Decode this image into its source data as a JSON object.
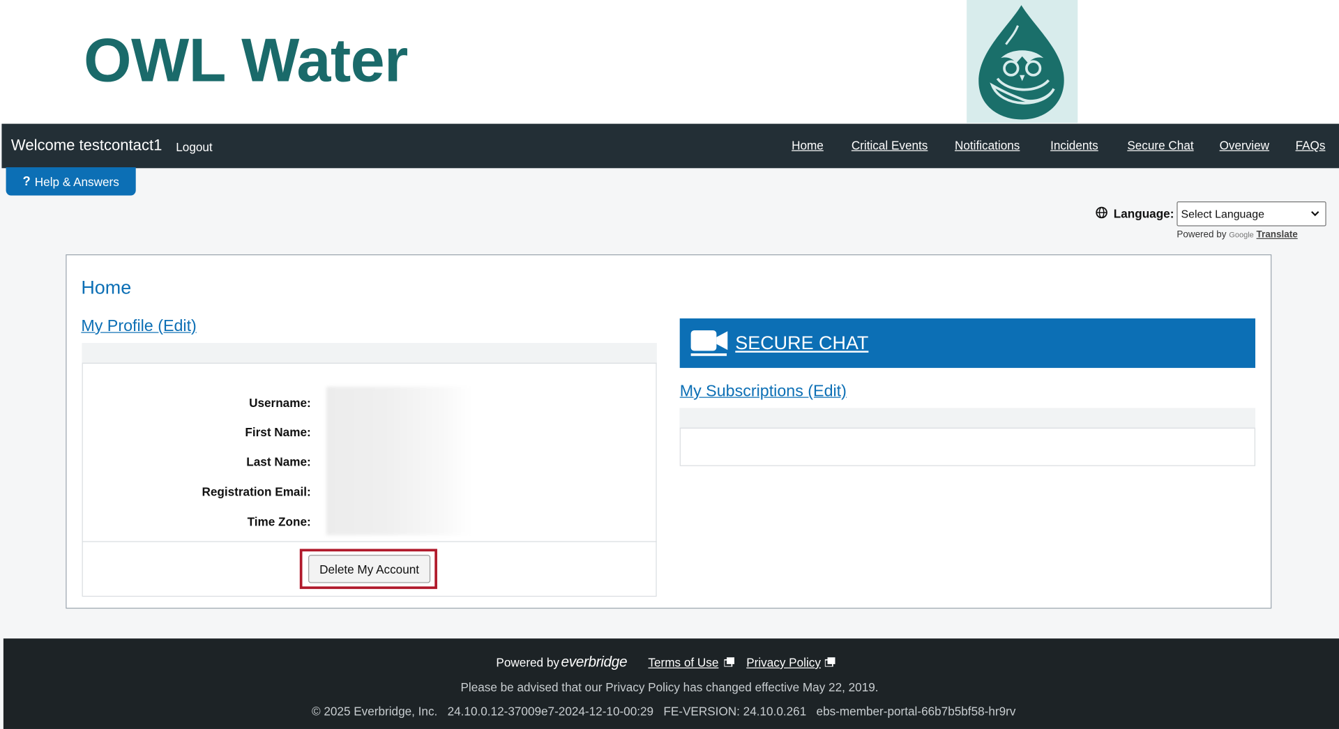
{
  "brand": {
    "title": "OWL Water"
  },
  "nav": {
    "welcome": "Welcome testcontact1",
    "logout": "Logout",
    "links": [
      "Home",
      "Critical Events",
      "Notifications",
      "Incidents",
      "Secure Chat",
      "Overview",
      "FAQs"
    ]
  },
  "help": {
    "label": "Help & Answers"
  },
  "language": {
    "label": "Language:",
    "selected": "Select Language",
    "powered_by": "Powered by",
    "google": "Google",
    "translate": "Translate"
  },
  "main": {
    "title": "Home",
    "profile_link": "My Profile (Edit)",
    "fields": [
      "Username:",
      "First Name:",
      "Last Name:",
      "Registration Email:",
      "Time Zone:"
    ],
    "delete_button": "Delete My Account",
    "secure_chat": "SECURE CHAT",
    "subscriptions_link": "My Subscriptions (Edit)"
  },
  "footer": {
    "powered_by": "Powered by",
    "brand": "everbridge",
    "terms": "Terms of Use",
    "privacy": "Privacy Policy",
    "notice": "Please be advised that our Privacy Policy has changed effective May 22, 2019.",
    "copyright": "© 2025 Everbridge, Inc.",
    "build": "24.10.0.12-37009e7-2024-12-10-00:29",
    "fe_version": "FE-VERSION: 24.10.0.261",
    "pod": "ebs-member-portal-66b7b5bf58-hr9rv"
  },
  "colors": {
    "brand_teal": "#1a6a6a",
    "accent_blue": "#0c6fb5",
    "nav_bg": "#232f36",
    "footer_bg": "#1d2326",
    "highlight_red": "#b0192b"
  }
}
